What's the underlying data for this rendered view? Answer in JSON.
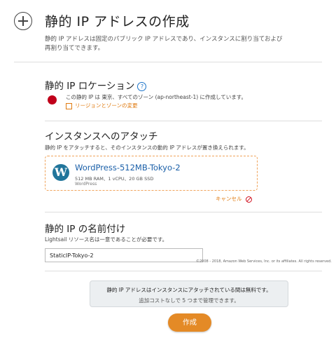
{
  "page": {
    "title": "静的 IP アドレスの作成",
    "description": "静的 IP アドレスは固定のパブリック IP アドレスであり、インスタンスに割り当ておよび再割り当てできます。"
  },
  "location": {
    "heading": "静的 IP ロケーション",
    "help": "?",
    "text": "この静的 IP は 東京、すべてのゾーン (ap-northeast-1) に作成しています。",
    "change_link": "リージョンとゾーンの変更"
  },
  "attach": {
    "heading": "インスタンスへのアタッチ",
    "description": "静的 IP をアタッチすると、そのインスタンスの動的 IP アドレスが置き換えられます。",
    "instance": {
      "name": "WordPress-512MB-Tokyo-2",
      "specs": "512 MB RAM、1 vCPU、20 GB SSD",
      "blueprint": "WordPress",
      "logo": "W"
    },
    "cancel_label": "キャンセル"
  },
  "naming": {
    "heading": "静的 IP の名前付け",
    "description": "Lightsail リソース名は一意であることが必要です。",
    "value": "StaticIP-Tokyo-2",
    "copyright": "©2008 - 2018, Amazon Web Services, Inc. or its affiliates. All rights reserved."
  },
  "notice": {
    "line1": "静的 IP アドレスはインスタンスにアタッチされている間は無料です。",
    "line2": "追加コストなしで 5 つまで管理できます。"
  },
  "actions": {
    "create_label": "作成"
  },
  "colors": {
    "accent": "#e48a26",
    "link": "#1a5fa8",
    "flag_red": "#c0001a"
  }
}
